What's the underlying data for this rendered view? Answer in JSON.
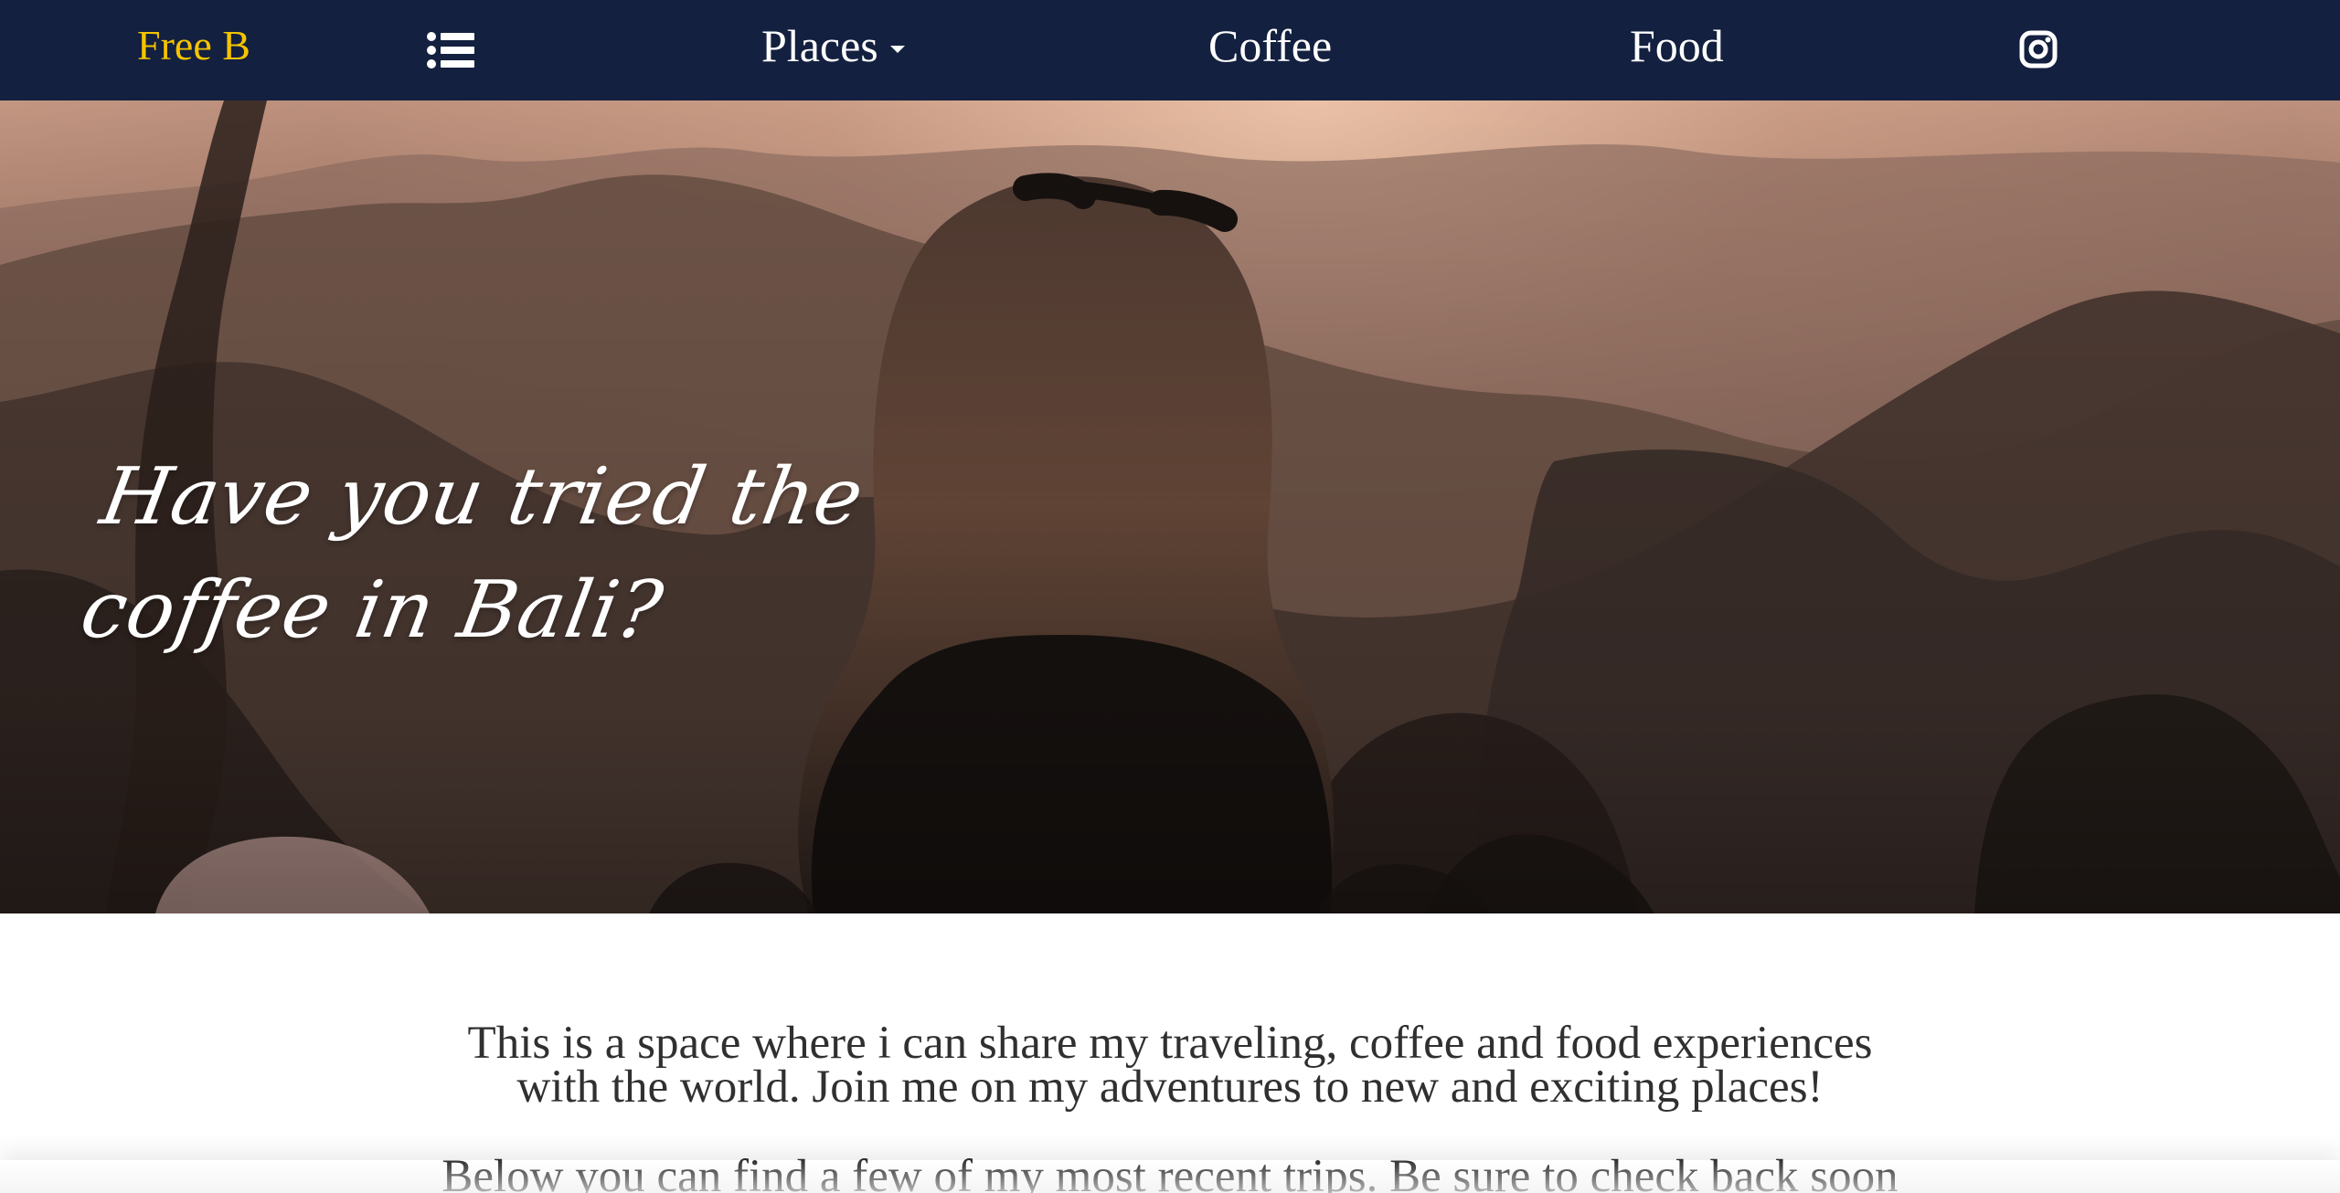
{
  "navbar": {
    "brand": "Free B",
    "menu_icon": "list-icon",
    "places_label": "Places",
    "coffee_label": "Coffee",
    "food_label": "Food",
    "instagram_icon": "instagram-icon"
  },
  "hero": {
    "heading_line_1": "Have you tried the",
    "heading_line_2": "coffee in Bali?"
  },
  "content": {
    "intro_line_1": "This is a space where i can share my traveling, coffee and food experiences",
    "intro_line_2": "with the world. Join me on my adventures to new and exciting places!",
    "recent_text": "Below you can find a few of my most recent trips. Be sure to check back soon"
  },
  "colors": {
    "navbar": "#13203f",
    "brand": "#f5c400",
    "nav_text": "#ffffff",
    "body_text": "#303030"
  }
}
